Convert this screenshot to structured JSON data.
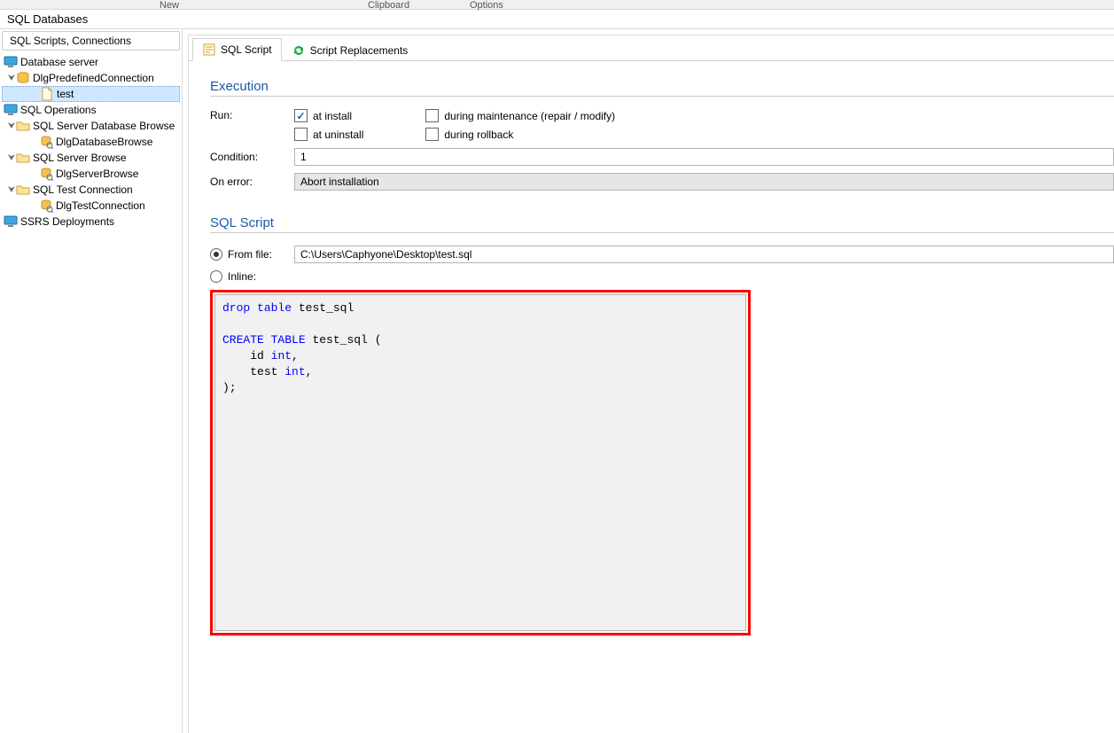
{
  "ribbon": {
    "group1": "New",
    "group2": "Clipboard",
    "group3": "Options"
  },
  "title": "SQL Databases",
  "sidebar": {
    "header": "SQL Scripts, Connections",
    "items": [
      {
        "label": "Database server"
      },
      {
        "label": "DlgPredefinedConnection"
      },
      {
        "label": "test"
      },
      {
        "label": "SQL Operations"
      },
      {
        "label": "SQL Server Database Browse"
      },
      {
        "label": "DlgDatabaseBrowse"
      },
      {
        "label": "SQL Server Browse"
      },
      {
        "label": "DlgServerBrowse"
      },
      {
        "label": "SQL Test Connection"
      },
      {
        "label": "DlgTestConnection"
      },
      {
        "label": "SSRS Deployments"
      }
    ]
  },
  "tabs": {
    "script": "SQL Script",
    "replace": "Script Replacements"
  },
  "execution": {
    "title": "Execution",
    "run_label": "Run:",
    "cb_install": "at install",
    "cb_uninstall": "at uninstall",
    "cb_maint": "during maintenance (repair / modify)",
    "cb_rollback": "during rollback",
    "condition_label": "Condition:",
    "condition_value": "1",
    "onerror_label": "On error:",
    "onerror_value": "Abort installation"
  },
  "script": {
    "title": "SQL Script",
    "fromfile_label": "From file:",
    "fromfile_value": "C:\\Users\\Caphyone\\Desktop\\test.sql",
    "inline_label": "Inline:",
    "sql_drop_kw1": "drop",
    "sql_drop_kw2": "table",
    "sql_drop_name": "test_sql",
    "sql_create_kw1": "CREATE",
    "sql_create_kw2": "TABLE",
    "sql_create_name": "test_sql",
    "sql_open": "(",
    "sql_col1_name": "id",
    "sql_col1_type": "int",
    "sql_comma": ",",
    "sql_col2_name": "test",
    "sql_col2_type": "int",
    "sql_close": ");"
  }
}
